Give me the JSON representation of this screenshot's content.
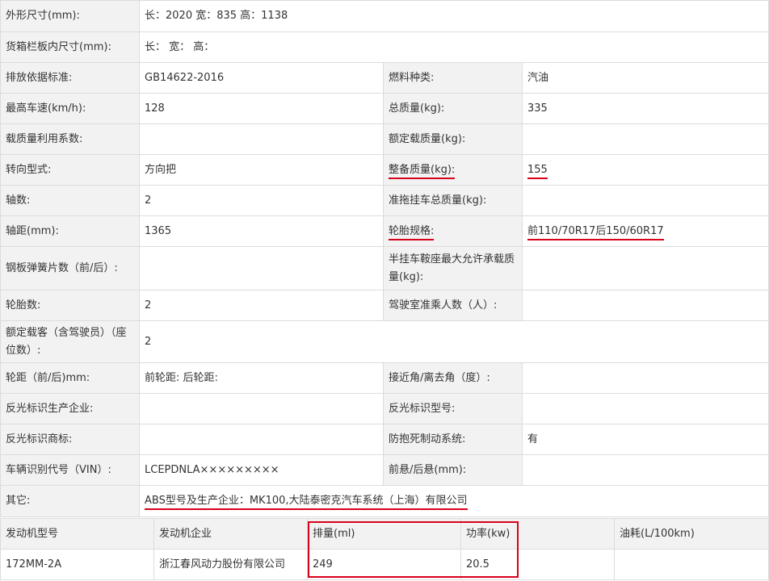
{
  "spec": {
    "dims_label": "外形尺寸(mm):",
    "dims_value": "长：2020 宽：835 高：1138",
    "cargo_label": "货箱栏板内尺寸(mm):",
    "cargo_value": "长： 宽： 高：",
    "emission_label": "排放依据标准:",
    "emission_value": "GB14622-2016",
    "fuel_label": "燃料种类:",
    "fuel_value": "汽油",
    "speed_label": "最高车速(km/h):",
    "speed_value": "128",
    "total_mass_label": "总质量(kg):",
    "total_mass_value": "335",
    "load_coef_label": "载质量利用系数:",
    "load_coef_value": "",
    "rated_load_label": "额定载质量(kg):",
    "rated_load_value": "",
    "steering_label": "转向型式:",
    "steering_value": "方向把",
    "curb_mass_label": "整备质量(kg):",
    "curb_mass_value": "155",
    "axles_label": "轴数:",
    "axles_value": "2",
    "trailer_mass_label": "准拖挂车总质量(kg):",
    "trailer_mass_value": "",
    "wheelbase_label": "轴距(mm):",
    "wheelbase_value": "1365",
    "tire_label": "轮胎规格:",
    "tire_value": "前110/70R17后150/60R17",
    "springs_label": "钢板弹簧片数（前/后）:",
    "springs_value": "",
    "saddle_label": "半挂车鞍座最大允许承载质量(kg):",
    "saddle_value": "",
    "tires_count_label": "轮胎数:",
    "tires_count_value": "2",
    "cab_label": "驾驶室准乘人数（人）:",
    "cab_value": "",
    "passengers_label": "额定载客（含驾驶员）（座位数）:",
    "passengers_value": "2",
    "track_label": "轮距（前/后)mm:",
    "track_value": "前轮距: 后轮距:",
    "angle_label": "接近角/离去角（度）:",
    "angle_value": "",
    "refl_maker_label": "反光标识生产企业:",
    "refl_maker_value": "",
    "refl_model_label": "反光标识型号:",
    "refl_model_value": "",
    "refl_brand_label": "反光标识商标:",
    "refl_brand_value": "",
    "abs_label": "防抱死制动系统:",
    "abs_value": "有",
    "vin_label": "车辆识别代号（VIN）:",
    "vin_value": "LCEPDNLA×××××××××",
    "overhang_label": "前悬/后悬(mm):",
    "overhang_value": "",
    "other_label": "其它:",
    "other_value": "ABS型号及生产企业：MK100,大陆泰密克汽车系统（上海）有限公司"
  },
  "engine": {
    "headers": [
      "发动机型号",
      "发动机企业",
      "排量(ml)",
      "功率(kw)",
      "油耗(L/100km)"
    ],
    "row": [
      "172MM-2A",
      "浙江春风动力股份有限公司",
      "249",
      "20.5",
      ""
    ]
  },
  "colors": {
    "highlight": "#d9001b",
    "label_bg": "#f2f2f2",
    "border": "#dcdcdc"
  }
}
